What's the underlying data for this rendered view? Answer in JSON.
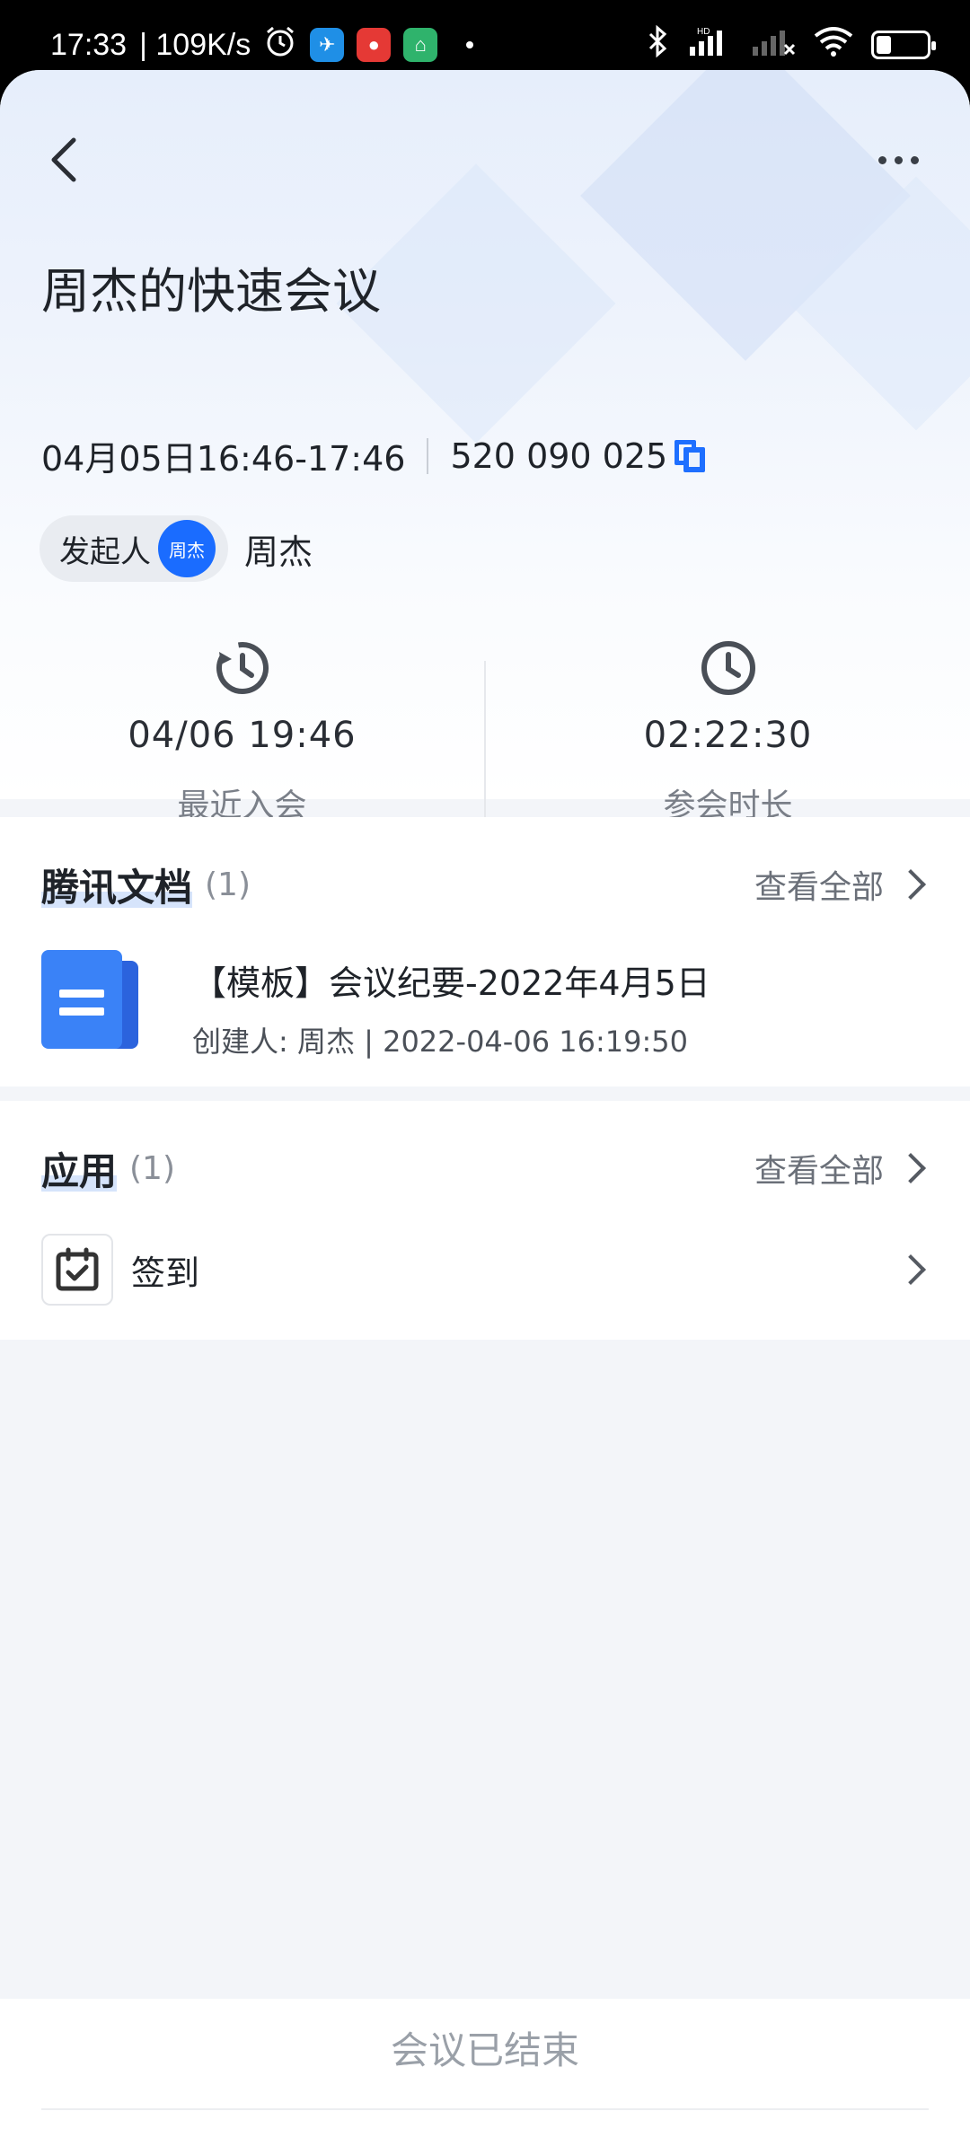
{
  "status_bar": {
    "time": "17:33",
    "speed": "| 109K/s",
    "icons": [
      "alarm-icon",
      "app1-icon",
      "app2-icon",
      "app3-icon",
      "bluetooth-icon",
      "hd-signal-icon",
      "signal-icon",
      "wifi-icon",
      "battery-icon"
    ],
    "battery_level": 0.3
  },
  "nav": {
    "back_icon": "chevron-left-icon",
    "more_icon": "more-horizontal-icon"
  },
  "meeting": {
    "title": "周杰的快速会议",
    "time_range": "04月05日16:46-17:46",
    "meeting_id": "520 090 025",
    "initiator_label": "发起人",
    "initiator_avatar_text": "周杰",
    "initiator_name": "周杰"
  },
  "stats": [
    {
      "icon": "history-clock-icon",
      "value": "04/06 19:46",
      "label": "最近入会"
    },
    {
      "icon": "clock-icon",
      "value": "02:22:30",
      "label": "参会时长"
    }
  ],
  "docs_section": {
    "title": "腾讯文档",
    "count": "(1)",
    "see_all": "查看全部",
    "items": [
      {
        "title": "【模板】会议纪要-2022年4月5日",
        "subtitle": "创建人: 周杰 | 2022-04-06 16:19:50"
      }
    ]
  },
  "apps_section": {
    "title": "应用",
    "count": "(1)",
    "see_all": "查看全部",
    "items": [
      {
        "label": "签到",
        "icon": "calendar-check-icon"
      }
    ]
  },
  "footer": {
    "status": "会议已结束"
  },
  "colors": {
    "accent": "#1e6fff",
    "avatar": "#1a6cff",
    "doc": "#3a82f7"
  }
}
